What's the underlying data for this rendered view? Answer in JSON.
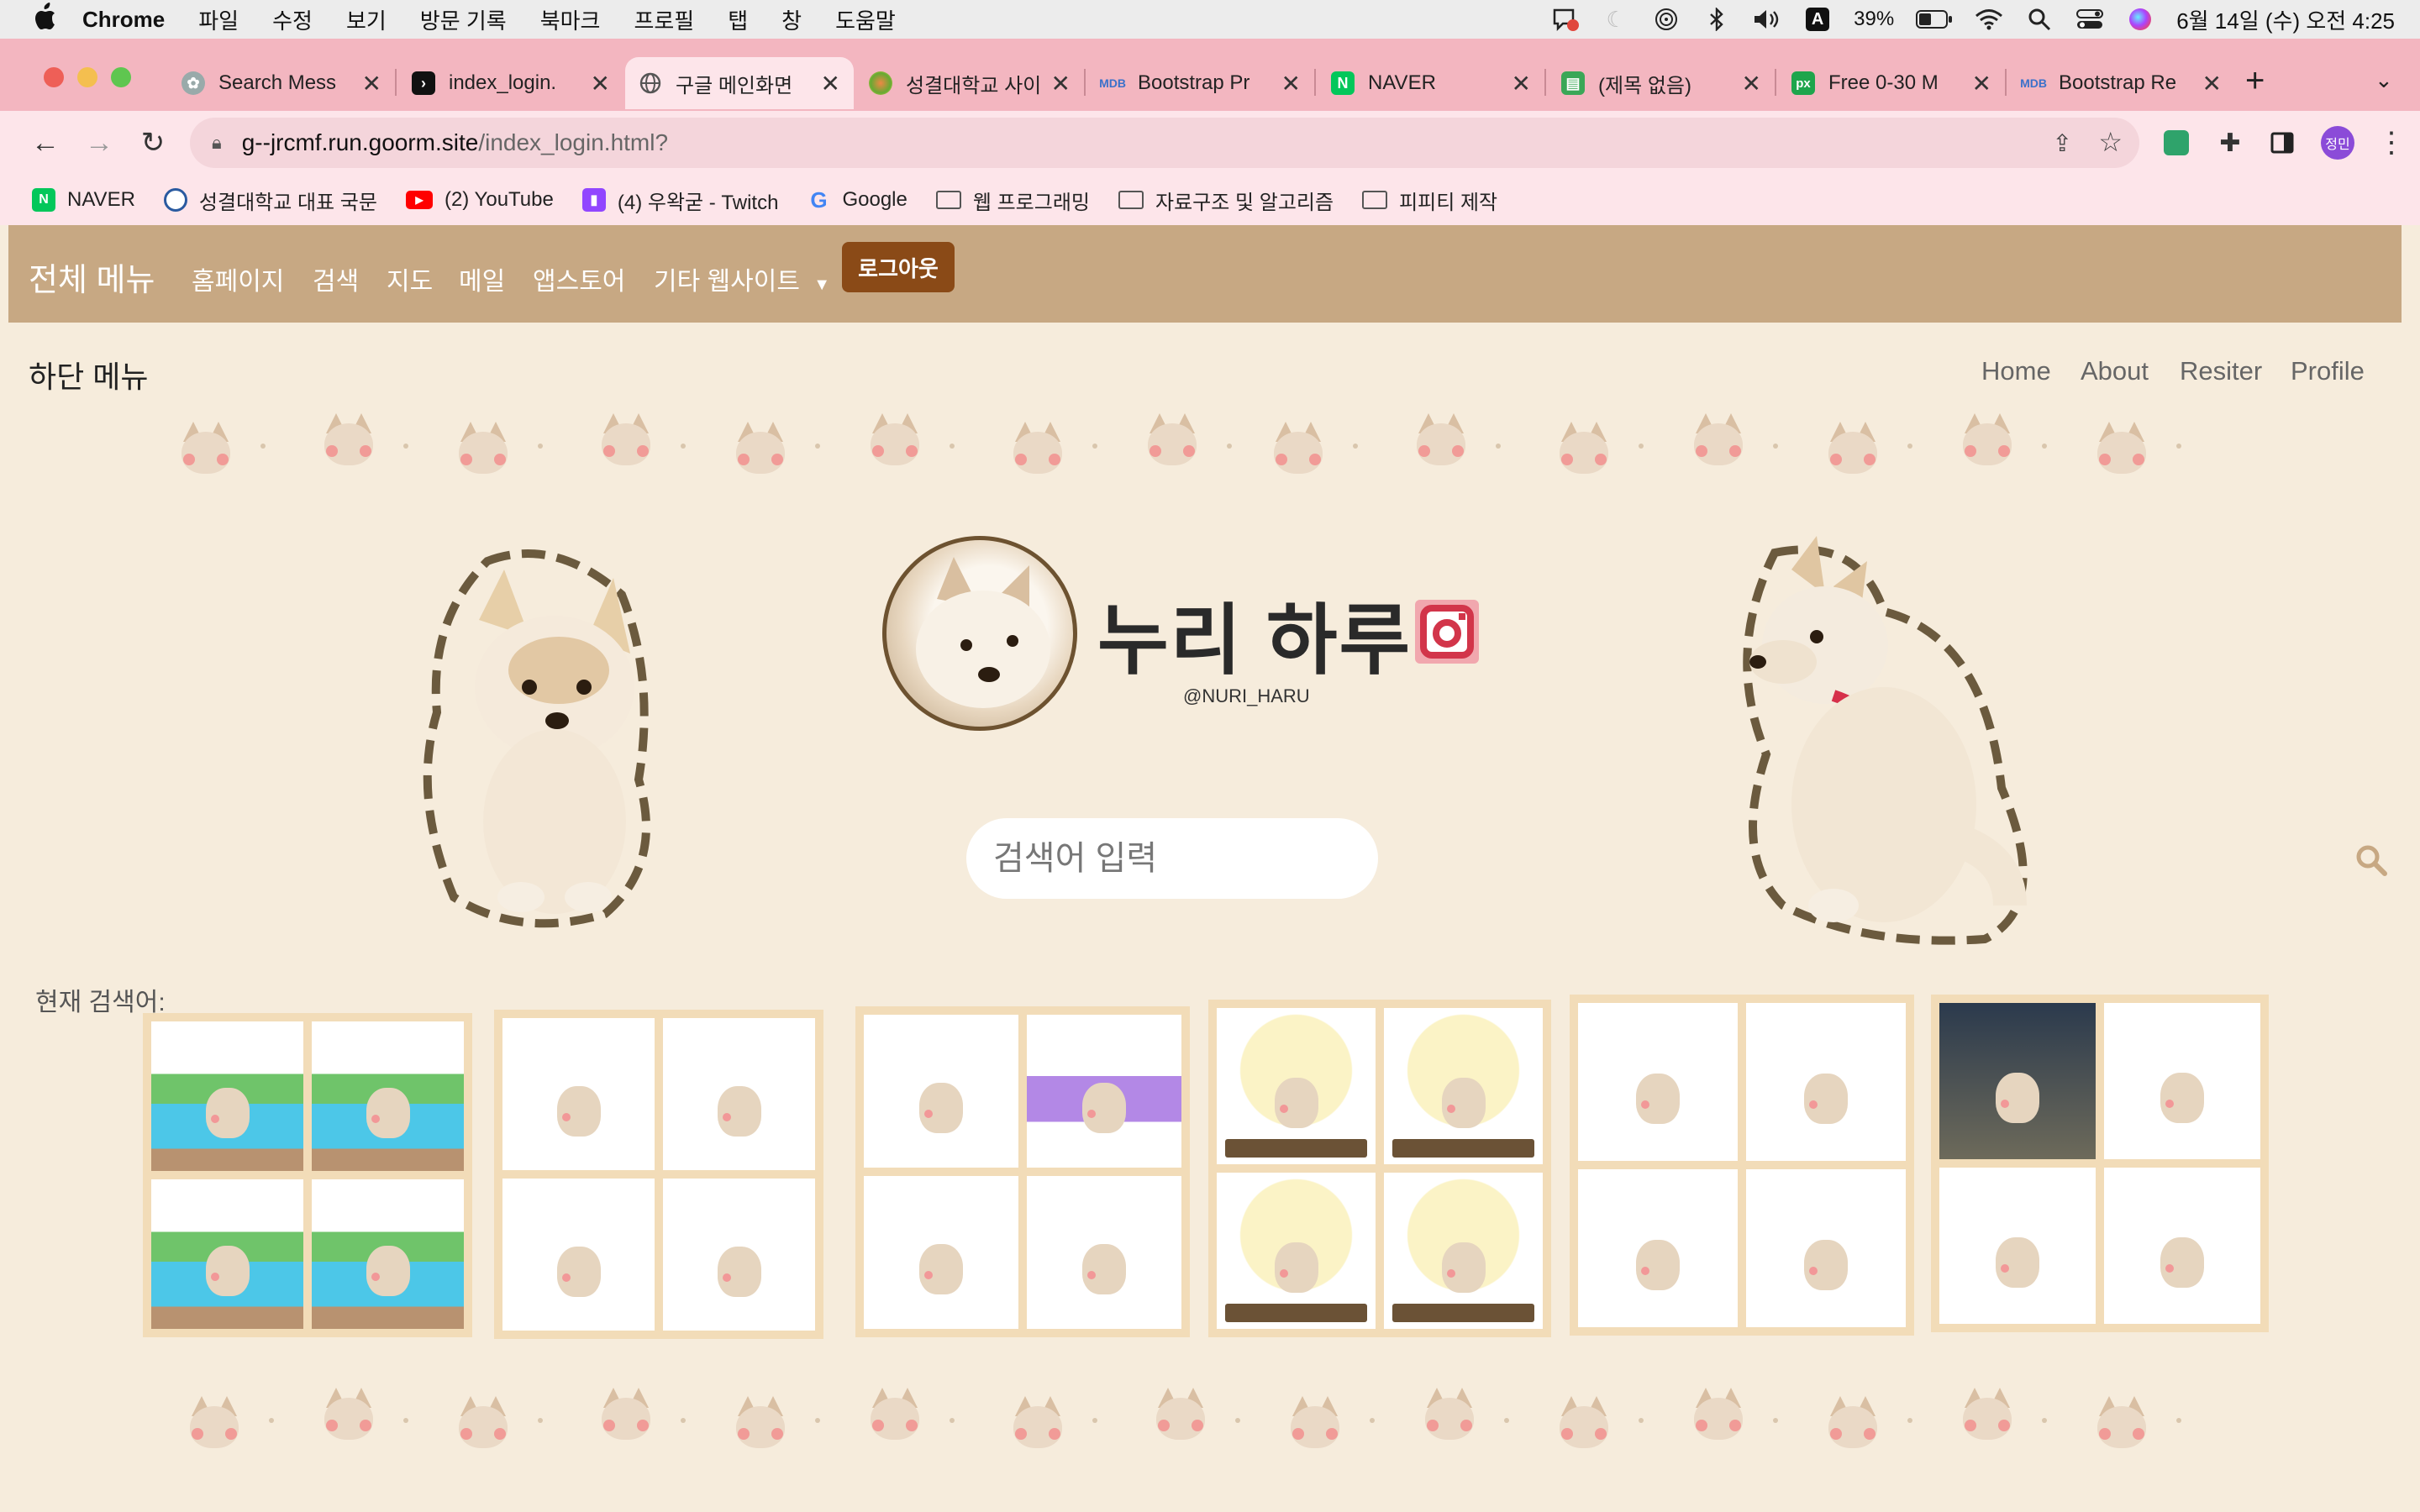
{
  "menubar": {
    "app_name": "Chrome",
    "items": [
      "파일",
      "수정",
      "보기",
      "방문 기록",
      "북마크",
      "프로필",
      "탭",
      "창",
      "도움말"
    ],
    "battery": "39%",
    "datetime": "6월 14일 (수) 오전 4:25"
  },
  "tabs": [
    {
      "title": "Search Mess",
      "favicon": "openai-icon",
      "active": false
    },
    {
      "title": "index_login.",
      "favicon": "terminal-icon",
      "active": false
    },
    {
      "title": "구글 메인화면",
      "favicon": "globe-icon",
      "active": true
    },
    {
      "title": "성결대학교 사이",
      "favicon": "university-icon",
      "active": false
    },
    {
      "title": "Bootstrap Pr",
      "favicon": "mdb-icon",
      "active": false
    },
    {
      "title": "NAVER",
      "favicon": "naver-icon",
      "active": false
    },
    {
      "title": "(제목 없음)",
      "favicon": "sheets-icon",
      "active": false
    },
    {
      "title": "Free 0-30 M",
      "favicon": "px-icon",
      "active": false
    },
    {
      "title": "Bootstrap Re",
      "favicon": "mdb-icon",
      "active": false
    }
  ],
  "address": {
    "host": "g--jrcmf.run.goorm.site",
    "path": "/index_login.html?"
  },
  "profile_initials": "정민",
  "bookmarks": [
    {
      "label": "NAVER",
      "icon": "naver-icon"
    },
    {
      "label": "성결대학교 대표 국문",
      "icon": "university-icon"
    },
    {
      "label": "(2) YouTube",
      "icon": "youtube-icon"
    },
    {
      "label": "(4) 우왁굳 - Twitch",
      "icon": "twitch-icon"
    },
    {
      "label": "Google",
      "icon": "google-icon"
    },
    {
      "label": "웹 프로그래밍",
      "icon": "folder-icon"
    },
    {
      "label": "자료구조 및 알고리즘",
      "icon": "folder-icon"
    },
    {
      "label": "피피티 제작",
      "icon": "folder-icon"
    }
  ],
  "site": {
    "brand": "전체 메뉴",
    "nav": [
      "홈페이지",
      "검색",
      "지도",
      "메일",
      "앱스토어",
      "기타 웹사이트"
    ],
    "logout": "로그아웃",
    "subnav_title": "하단 메뉴",
    "subnav": [
      "Home",
      "About",
      "Resiter",
      "Profile"
    ],
    "title": "누리 하루",
    "handle": "@NURI_HARU",
    "search_placeholder": "검색어 입력",
    "current_search_label": "현재 검색어:"
  },
  "colors": {
    "nav_bg": "#c7a883",
    "logout_bg": "#8a4a17",
    "page_bg": "#f6ecdc",
    "tab_strip": "#f3b6c0"
  }
}
